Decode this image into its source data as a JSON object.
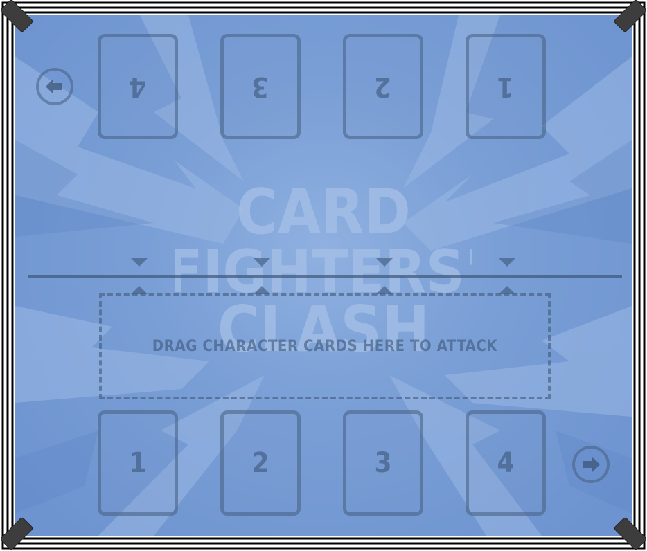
{
  "opponent_slots": [
    "4",
    "3",
    "2",
    "1"
  ],
  "player_slots": [
    "1",
    "2",
    "3",
    "4"
  ],
  "drop_zone": {
    "label": "DRAG CHARACTER CARDS HERE TO ATTACK"
  },
  "nav": {
    "back_icon": "arrow-left-icon",
    "next_icon": "arrow-right-icon"
  },
  "logo": {
    "line1": "CARD",
    "line2": "FIGHTERS'",
    "line3": "CLASH"
  },
  "colors": {
    "board": "#7a9fd6",
    "slot_border": "#465f82",
    "frame": "#000000"
  }
}
